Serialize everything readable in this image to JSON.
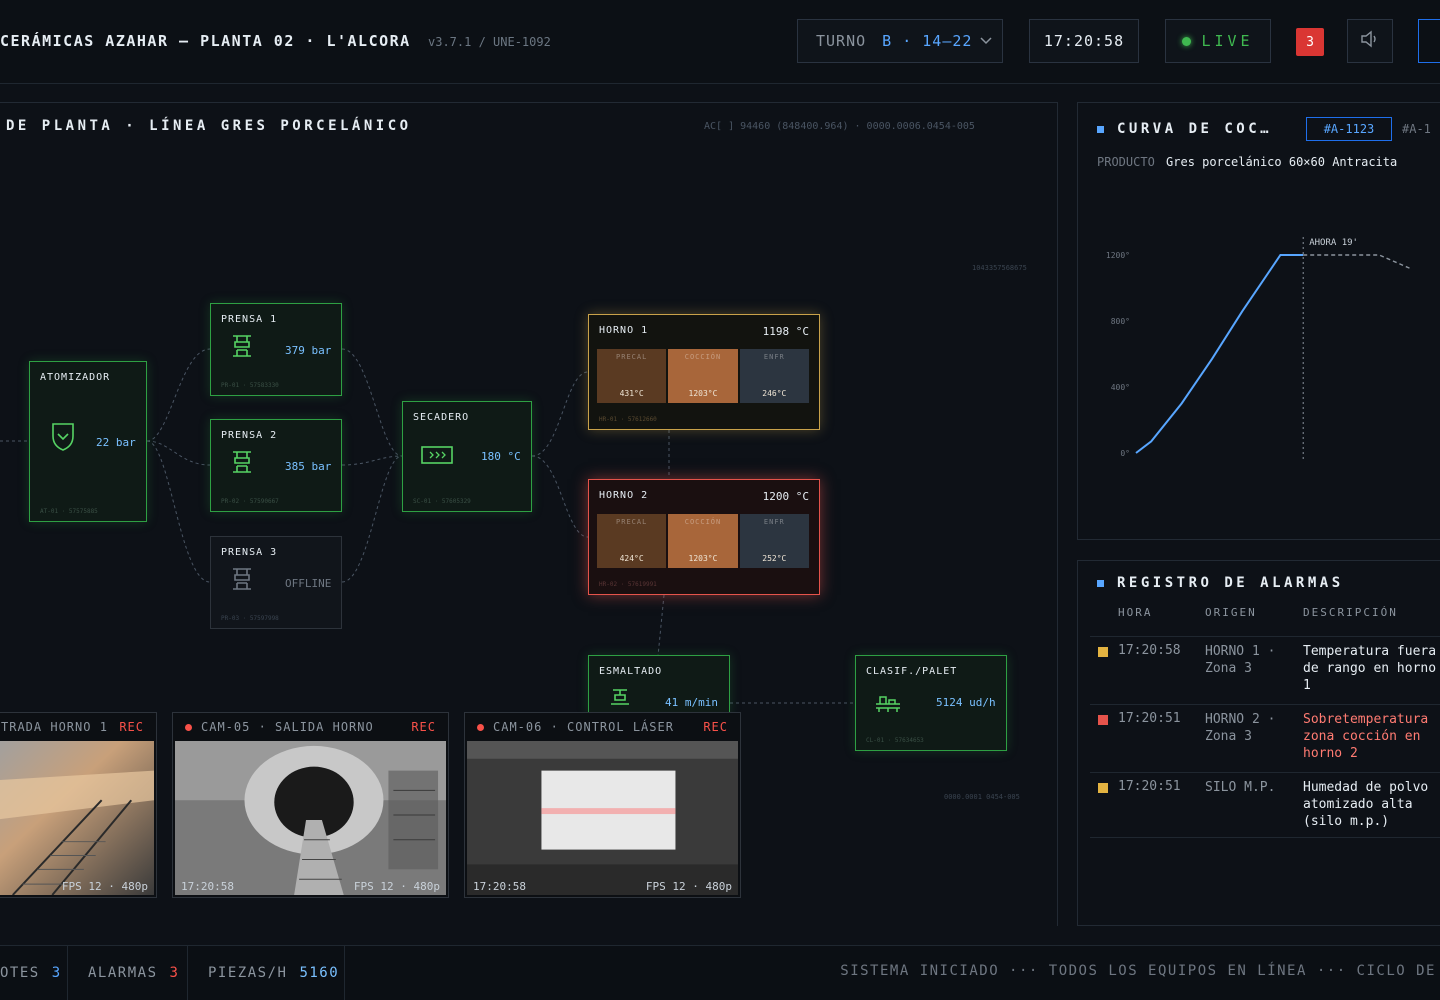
{
  "header": {
    "title": "CERÁMICAS AZAHAR — PLANTA 02 · L'ALCORA",
    "version": "v3.7.1 / UNE-1092",
    "shift_label": "TURNO",
    "shift_value": "B · 14–22",
    "clock": "17:20:58",
    "live_label": "LIVE",
    "alarm_count": "3",
    "colors": {
      "accent": "#58a6ff",
      "live": "#3fb950",
      "alarm": "#da3633"
    }
  },
  "plant": {
    "title": "DE PLANTA · LÍNEA GRES PORCELÁNICO",
    "meta": "AC[ ] 94460 (848400.964) · 0000.0006.0454-005",
    "micro_top": "1043357568675",
    "micro_bottom": "0000.0001 0454-005",
    "nodes": {
      "atomizador": {
        "title": "ATOMIZADOR",
        "value": "22 bar",
        "id": "AT-01 · 57575885"
      },
      "prensa1": {
        "title": "PRENSA 1",
        "value": "379 bar",
        "id": "PR-01 · 57583330"
      },
      "prensa2": {
        "title": "PRENSA 2",
        "value": "385 bar",
        "id": "PR-02 · 57590667"
      },
      "prensa3": {
        "title": "PRENSA 3",
        "value": "OFFLINE",
        "id": "PR-03 · 57597998"
      },
      "secadero": {
        "title": "SECADERO",
        "value": "180 °C",
        "id": "SC-01 · 57605329"
      },
      "horno1": {
        "title": "HORNO 1",
        "value": "1198 °C",
        "id": "HR-01 · 57612660",
        "zones": [
          {
            "name": "PRECAL",
            "temp": "431°C",
            "color": "#5a3a22"
          },
          {
            "name": "COCCIÓN",
            "temp": "1203°C",
            "color": "#a8663a"
          },
          {
            "name": "ENFR",
            "temp": "246°C",
            "color": "#2c3540"
          }
        ]
      },
      "horno2": {
        "title": "HORNO 2",
        "value": "1200 °C",
        "id": "HR-02 · 57619991",
        "zones": [
          {
            "name": "PRECAL",
            "temp": "424°C",
            "color": "#5a3a22"
          },
          {
            "name": "COCCIÓN",
            "temp": "1203°C",
            "color": "#a8663a"
          },
          {
            "name": "ENFR",
            "temp": "252°C",
            "color": "#2c3540"
          }
        ]
      },
      "esmaltado": {
        "title": "ESMALTADO",
        "value": "41 m/min"
      },
      "clasif": {
        "title": "CLASIF./PALET",
        "value": "5124 ud/h",
        "id": "CL-01 · 57634653"
      }
    }
  },
  "cameras": [
    {
      "label": "TRADA HORNO 1",
      "rec": "REC",
      "ts": "",
      "fps": "FPS 12 · 480p"
    },
    {
      "label": "CAM-05 · SALIDA HORNO",
      "rec": "REC",
      "ts": "17:20:58",
      "fps": "FPS 12 · 480p"
    },
    {
      "label": "CAM-06 · CONTROL LÁSER",
      "rec": "REC",
      "ts": "17:20:58",
      "fps": "FPS 12 · 480p"
    }
  ],
  "curve": {
    "title": "CURVA DE COC…",
    "lot_active": "#A-1123",
    "lot_next": "#A-1",
    "product_label": "PRODUCTO",
    "product_value": "Gres porcelánico 60×60 Antracita",
    "now_label": "AHORA 19'"
  },
  "chart_data": {
    "type": "line",
    "title": "CURVA DE COC…",
    "xlabel": "",
    "ylabel": "",
    "ylim": [
      0,
      1200
    ],
    "yticks": [
      "1200°",
      "800°",
      "400°",
      "0°"
    ],
    "series": [
      {
        "values": [
          {
            "x": 0,
            "y": 0
          },
          {
            "x": 1,
            "y": 70
          },
          {
            "x": 3,
            "y": 300
          },
          {
            "x": 5,
            "y": 570
          },
          {
            "x": 7,
            "y": 860
          },
          {
            "x": 9.5,
            "y": 1200
          },
          {
            "x": 11,
            "y": 1200
          },
          {
            "x": 16,
            "y": 1200
          },
          {
            "x": 18,
            "y": 1120
          }
        ]
      }
    ],
    "xlim": [
      0,
      20
    ],
    "now_x": 11,
    "grid": false
  },
  "alarms": {
    "title": "REGISTRO DE ALARMAS",
    "headers": [
      "HORA",
      "ORIGEN",
      "DESCRIPCIÓN"
    ],
    "rows": [
      {
        "time": "17:20:58",
        "origin_1": "HORNO 1 ·",
        "origin_2": "Zona 3",
        "desc_1": "Temperatura fuera",
        "desc_2": "de rango en horno",
        "desc_3": "1",
        "color": "#e3b341",
        "desc_color": "#e6edf3"
      },
      {
        "time": "17:20:51",
        "origin_1": "HORNO 2 ·",
        "origin_2": "Zona 3",
        "desc_1": "Sobretemperatura",
        "desc_2": "zona cocción en",
        "desc_3": "horno 2",
        "color": "#e5534b",
        "desc_color": "#ff7b72"
      },
      {
        "time": "17:20:51",
        "origin_1": "SILO M.P.",
        "origin_2": "",
        "desc_1": "Humedad de polvo",
        "desc_2": "atomizado alta",
        "desc_3": "(silo m.p.)",
        "color": "#e3b341",
        "desc_color": "#e6edf3"
      }
    ]
  },
  "footer": {
    "lotes_label": "OTES",
    "lotes_value": "3",
    "alarmas_label": "ALARMAS",
    "alarmas_value": "3",
    "piezas_label": "PIEZAS/H",
    "piezas_value": "5160",
    "ticker": "SISTEMA INICIADO ··· TODOS LOS EQUIPOS EN LÍNEA ··· CICLO DE"
  }
}
